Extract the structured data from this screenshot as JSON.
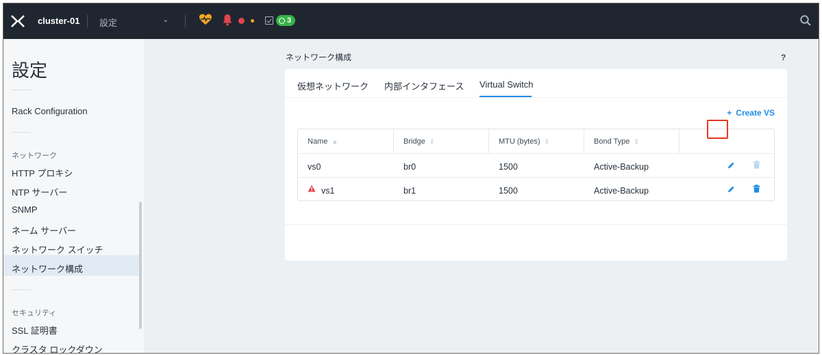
{
  "topbar": {
    "cluster_name": "cluster-01",
    "breadcrumb": "設定",
    "dropdown_caret": "⌄",
    "tasks_count": "3",
    "health_color": "#f5a623",
    "alert_color": "#e2444e",
    "tasks_color": "#37b34a"
  },
  "sidebar": {
    "title": "設定",
    "rack_configuration": "Rack Configuration",
    "network_section": "ネットワーク",
    "items": [
      {
        "label": "HTTP プロキシ"
      },
      {
        "label": "NTP サーバー"
      },
      {
        "label": "SNMP"
      },
      {
        "label": "ネーム サーバー"
      },
      {
        "label": "ネットワーク スイッチ"
      },
      {
        "label": "ネットワーク構成"
      }
    ],
    "security_section": "セキュリティ",
    "security_items": [
      {
        "label": "SSL 証明書"
      },
      {
        "label": "クラスタ ロックダウン"
      }
    ]
  },
  "main": {
    "title": "ネットワーク構成",
    "help": "?",
    "tabs": [
      {
        "label": "仮想ネットワーク"
      },
      {
        "label": "内部インタフェース"
      },
      {
        "label": "Virtual Switch"
      }
    ],
    "active_tab": "Virtual Switch",
    "create_vs_plus": "+",
    "create_vs_label": "Create VS",
    "accent_color": "#1f8ce6",
    "table": {
      "columns": [
        "Name",
        "Bridge",
        "MTU (bytes)",
        "Bond Type"
      ],
      "rows": [
        {
          "name": "vs0",
          "bridge": "br0",
          "mtu": "1500",
          "bond_type": "Active-Backup",
          "warning": false
        },
        {
          "name": "vs1",
          "bridge": "br1",
          "mtu": "1500",
          "bond_type": "Active-Backup",
          "warning": true
        }
      ]
    }
  }
}
